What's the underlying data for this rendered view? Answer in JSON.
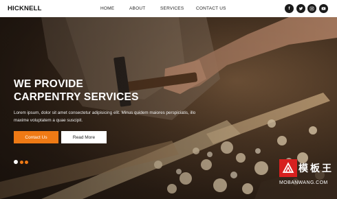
{
  "brand": "HICKNELL",
  "nav": {
    "items": [
      "HOME",
      "ABOUT",
      "SERVICES",
      "CONTACT US"
    ]
  },
  "socials": [
    {
      "icon": "facebook-icon",
      "glyph": "f"
    },
    {
      "icon": "twitter-icon",
      "glyph": ""
    },
    {
      "icon": "instagram-icon",
      "glyph": ""
    },
    {
      "icon": "youtube-icon",
      "glyph": ""
    }
  ],
  "hero": {
    "title_line1": "WE PROVIDE",
    "title_line2": "CARPENTRY SERVICES",
    "description": "Lorem ipsum, dolor sit amet consectetur adipisicing elit. Minus quidem maiores perspiciatis, illo maxime voluptatem a quae suscipit.",
    "primary_button": "Contact Us",
    "secondary_button": "Read More",
    "slides": 3,
    "active_slide": 1
  },
  "colors": {
    "accent": "#ef7a15",
    "navbar_bg": "#ffffff",
    "social_bg": "#1a1a1a"
  },
  "watermark": {
    "zh": "模板王",
    "en": "MOBANWANG.COM"
  }
}
